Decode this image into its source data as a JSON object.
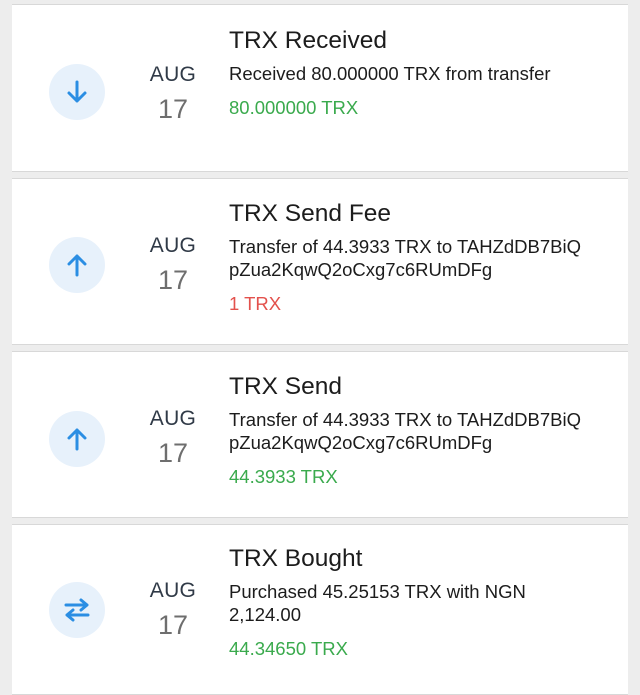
{
  "colors": {
    "background": "#ededed",
    "card": "#ffffff",
    "icon_circle_bg": "#e7f1fb",
    "icon_color": "#2b8ee3",
    "amount_positive": "#3aaa4d",
    "amount_negative": "#e3514c"
  },
  "transactions": [
    {
      "icon": "arrow-down-icon",
      "month": "AUG",
      "day": "17",
      "title": "TRX Received",
      "description": "Received 80.000000 TRX from transfer",
      "amount": "80.000000 TRX",
      "amount_color": "#3aaa4d"
    },
    {
      "icon": "arrow-up-icon",
      "month": "AUG",
      "day": "17",
      "title": "TRX Send Fee",
      "description": "Transfer of 44.3933 TRX to TAHZdDB7BiQ\npZua2KqwQ2oCxg7c6RUmDFg",
      "amount": "1 TRX",
      "amount_color": "#e3514c"
    },
    {
      "icon": "arrow-up-icon",
      "month": "AUG",
      "day": "17",
      "title": "TRX Send",
      "description": "Transfer of 44.3933 TRX to TAHZdDB7BiQ\npZua2KqwQ2oCxg7c6RUmDFg",
      "amount": "44.3933 TRX",
      "amount_color": "#3aaa4d"
    },
    {
      "icon": "swap-icon",
      "month": "AUG",
      "day": "17",
      "title": "TRX Bought",
      "description": "Purchased 45.25153 TRX with NGN\n2,124.00",
      "amount": "44.34650 TRX",
      "amount_color": "#3aaa4d"
    }
  ]
}
